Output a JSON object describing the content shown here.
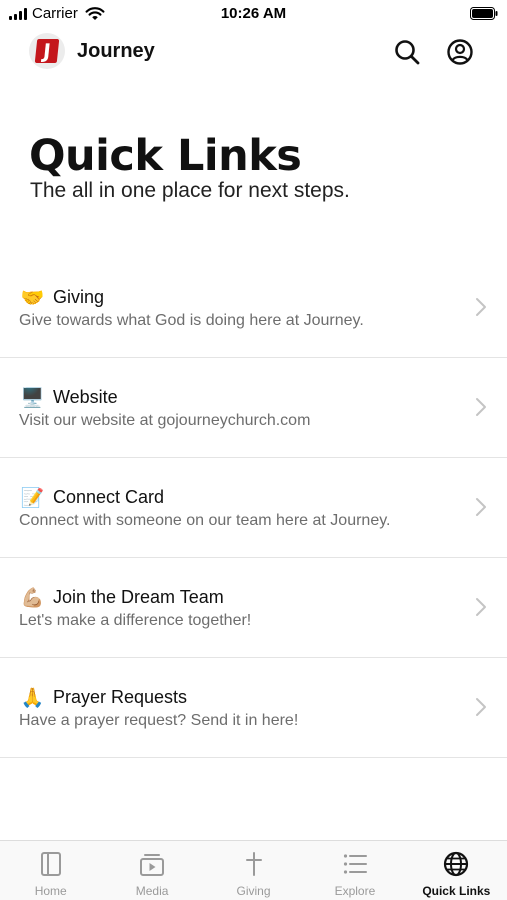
{
  "status_bar": {
    "carrier": "Carrier",
    "time": "10:26 AM"
  },
  "header": {
    "logo_letter": "J",
    "title": "Journey",
    "search_icon": "search-icon",
    "profile_icon": "profile-icon"
  },
  "hero": {
    "title": "Quick Links",
    "subtitle": "The all in one place for next steps."
  },
  "links": [
    {
      "emoji": "🤝",
      "title": "Giving",
      "description": "Give towards what God is doing here at Journey."
    },
    {
      "emoji": "🖥️",
      "title": "Website",
      "description": "Visit our website at gojourneychurch.com"
    },
    {
      "emoji": "📝",
      "title": "Connect Card",
      "description": "Connect with someone on our team here at Journey."
    },
    {
      "emoji": "💪🏼",
      "title": "Join the Dream Team",
      "description": "Let's make a difference together!"
    },
    {
      "emoji": "🙏",
      "title": "Prayer Requests",
      "description": "Have a prayer request? Send it in here!"
    }
  ],
  "tabs": [
    {
      "label": "Home",
      "icon": "home-icon"
    },
    {
      "label": "Media",
      "icon": "media-icon"
    },
    {
      "label": "Giving",
      "icon": "cross-icon"
    },
    {
      "label": "Explore",
      "icon": "list-icon"
    },
    {
      "label": "Quick Links",
      "icon": "globe-icon",
      "active": true
    }
  ],
  "colors": {
    "brand_red": "#c4161c",
    "muted_text": "#6d6d6d",
    "tab_inactive": "#9a9a9a"
  }
}
